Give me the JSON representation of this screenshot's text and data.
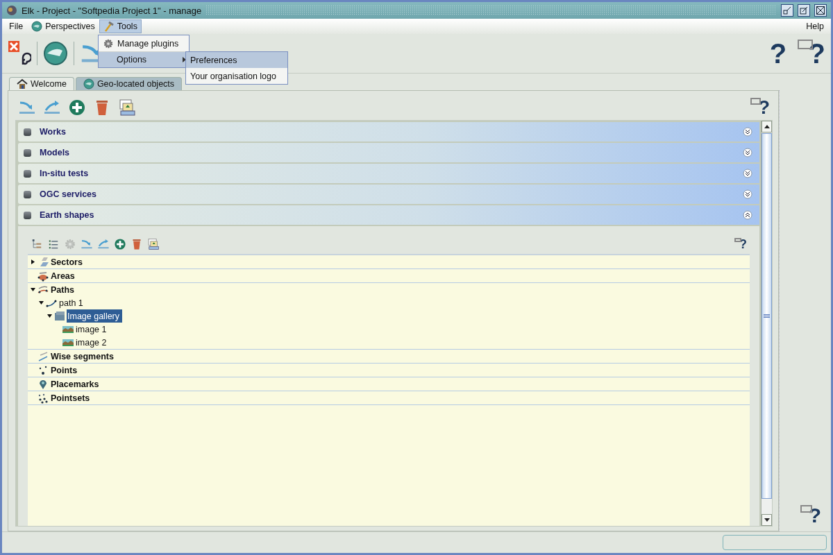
{
  "window": {
    "title": "Elk - Project - \"Softpedia Project 1\" - manage"
  },
  "help_marks": {
    "toolbar": [
      "?",
      "?"
    ],
    "panel": "?",
    "section": "?",
    "side": "?"
  },
  "menubar": [
    {
      "label": "File",
      "selected": false
    },
    {
      "label": "Perspectives",
      "selected": false
    },
    {
      "label": "Tools",
      "selected": true
    },
    {
      "label": "Help",
      "selected": false
    }
  ],
  "tools_menu": [
    {
      "label": "Manage plugins",
      "kind": "item",
      "selected": false
    },
    {
      "label": "Options",
      "kind": "submenu",
      "selected": true
    }
  ],
  "options_submenu": [
    {
      "label": "Preferences",
      "selected": true
    },
    {
      "label": "Your organisation logo",
      "selected": false
    }
  ],
  "tabs": [
    {
      "label": "Welcome",
      "selected": false
    },
    {
      "label": "Geo-located objects",
      "selected": true
    }
  ],
  "sections": [
    {
      "label": "Works",
      "expanded": false
    },
    {
      "label": "Models",
      "expanded": false
    },
    {
      "label": "In-situ tests",
      "expanded": false
    },
    {
      "label": "OGC services",
      "expanded": false
    },
    {
      "label": "Earth shapes",
      "expanded": true,
      "toolbar": [
        {
          "kind": "tree",
          "disabled": false
        },
        {
          "kind": "list",
          "disabled": false
        },
        {
          "kind": "gear",
          "disabled": true
        },
        {
          "kind": "import",
          "disabled": false
        },
        {
          "kind": "export",
          "disabled": false
        },
        {
          "kind": "add",
          "disabled": false
        },
        {
          "kind": "delete",
          "disabled": false
        },
        {
          "kind": "upload",
          "disabled": false
        }
      ],
      "tree": [
        {
          "label": "Sectors",
          "kind": "sector",
          "expanded": false,
          "selected": false
        },
        {
          "label": "Areas",
          "kind": "area",
          "selected": false
        },
        {
          "label": "Paths",
          "kind": "path",
          "expanded": true,
          "selected": false,
          "children": [
            {
              "label": "path 1",
              "kind": "polyline",
              "expanded": true,
              "selected": false,
              "children": [
                {
                  "label": "Image gallery",
                  "kind": "folder",
                  "expanded": true,
                  "selected": true,
                  "children": [
                    {
                      "label": "image 1",
                      "kind": "image",
                      "selected": false
                    },
                    {
                      "label": "image 2",
                      "kind": "image",
                      "selected": false
                    }
                  ]
                }
              ]
            }
          ]
        },
        {
          "label": "Wise segments",
          "kind": "segment",
          "selected": false
        },
        {
          "label": "Points",
          "kind": "point",
          "selected": false
        },
        {
          "label": "Placemarks",
          "kind": "placemark",
          "selected": false
        },
        {
          "label": "Pointsets",
          "kind": "pointset",
          "selected": false
        }
      ]
    }
  ]
}
